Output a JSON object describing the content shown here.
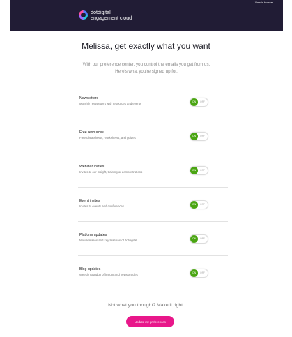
{
  "header": {
    "browser_link": "View in browser",
    "brand_line1": "dotdigital",
    "brand_line2": "engagement cloud"
  },
  "title": "Melissa, get exactly what you want",
  "intro": "With our preference center, you control the emails you get from us. Here's what you're signed up for.",
  "preferences": [
    {
      "name": "Newsletters",
      "description": "Monthly newsletters with resources and events",
      "on_label": "ON",
      "off_label": "OFF",
      "enabled": true
    },
    {
      "name": "Free resources",
      "description": "Free cheatsheets, worksheets, and guides",
      "on_label": "ON",
      "off_label": "OFF",
      "enabled": true
    },
    {
      "name": "Webinar invites",
      "description": "Invites to our insight, training or demonstrations",
      "on_label": "ON",
      "off_label": "OFF",
      "enabled": true
    },
    {
      "name": "Event invites",
      "description": "Invites to events and conferences",
      "on_label": "ON",
      "off_label": "OFF",
      "enabled": true
    },
    {
      "name": "Platform updates",
      "description": "New releases and key features of dotdigital",
      "on_label": "ON",
      "off_label": "OFF",
      "enabled": true
    },
    {
      "name": "Blog updates",
      "description": "Weekly roundup of insight and news articles",
      "on_label": "ON",
      "off_label": "OFF",
      "enabled": true
    }
  ],
  "footer": {
    "text": "Not what you thought? Make it right.",
    "button": "Update my preferences"
  },
  "colors": {
    "header_bg": "#211c35",
    "toggle_on": "#4aa512",
    "button": "#e8178a"
  }
}
